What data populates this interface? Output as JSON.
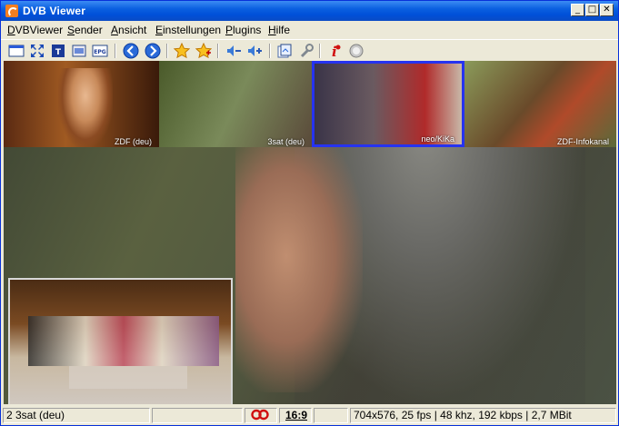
{
  "window": {
    "title": "DVB Viewer"
  },
  "menu": [
    {
      "label": "DVBViewer",
      "key": "D",
      "rest": "VBViewer"
    },
    {
      "label": "Sender",
      "key": "S",
      "rest": "ender"
    },
    {
      "label": "Ansicht",
      "key": "A",
      "rest": "nsicht"
    },
    {
      "label": "Einstellungen",
      "key": "E",
      "rest": "instellungen"
    },
    {
      "label": "Plugins",
      "key": "P",
      "rest": "lugins"
    },
    {
      "label": "Hilfe",
      "key": "H",
      "rest": "ilfe"
    }
  ],
  "thumbnails": [
    {
      "label": "ZDF (deu)"
    },
    {
      "label": "3sat (deu)"
    },
    {
      "label": "neo/KiKa"
    },
    {
      "label": "ZDF-Infokanal"
    }
  ],
  "statusbar": {
    "channel": "2 3sat (deu)",
    "aspect": "16:9",
    "stream_info": "704x576, 25 fps | 48 khz, 192 kbps | 2,7 MBit"
  },
  "colors": {
    "title_bar": "#0a5fe0",
    "selected_thumb_border": "#2633f0",
    "record_icon": "#d01010"
  }
}
